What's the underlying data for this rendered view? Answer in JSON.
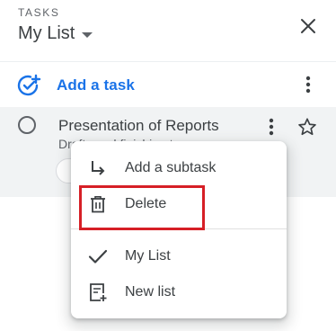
{
  "header": {
    "eyebrow": "TASKS",
    "list_name": "My List"
  },
  "toolbar": {
    "add_task_label": "Add a task"
  },
  "task": {
    "title": "Presentation of Reports",
    "details_visible": "Drafts and finishing t"
  },
  "context_menu": {
    "items": [
      {
        "label": "Add a subtask",
        "icon": "subtask-arrow-icon"
      },
      {
        "label": "Delete",
        "icon": "trash-icon"
      },
      {
        "label": "My List",
        "icon": "check-icon"
      },
      {
        "label": "New list",
        "icon": "new-list-icon"
      }
    ]
  },
  "colors": {
    "accent": "#1a73e8",
    "highlight": "#d61f26",
    "task_background": "#f1f3f4"
  }
}
